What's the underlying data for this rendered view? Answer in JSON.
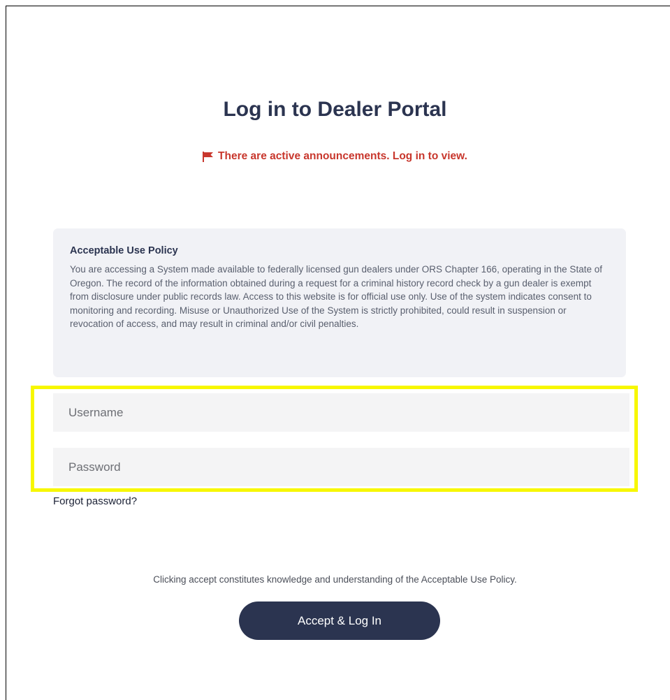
{
  "header": {
    "title": "Log in to Dealer Portal",
    "announcement": "There are active announcements. Log in to view."
  },
  "policy": {
    "heading": "Acceptable Use Policy",
    "text": "You are accessing a System made available to federally licensed gun dealers under ORS Chapter 166, operating in the State of Oregon. The record of the information obtained during a request for a criminal history record check by a gun dealer is exempt from disclosure under public records law. Access to this website is for official use only. Use of the system indicates consent to monitoring and recording. Misuse or Unauthorized Use of the System is strictly prohibited, could result in suspension or revocation of access, and may result in criminal and/or civil penalties."
  },
  "form": {
    "username_placeholder": "Username",
    "username_value": "",
    "password_placeholder": "Password",
    "password_value": "",
    "forgot_label": "Forgot password?"
  },
  "footer": {
    "consent_text": "Clicking accept constitutes knowledge and understanding of the Acceptable Use Policy.",
    "accept_label": "Accept & Log In"
  },
  "icons": {
    "announcement": "flag-icon"
  },
  "colors": {
    "primary": "#2b3450",
    "alert": "#c8372d",
    "highlight": "#f7f700",
    "policy_bg": "#f1f2f6"
  }
}
